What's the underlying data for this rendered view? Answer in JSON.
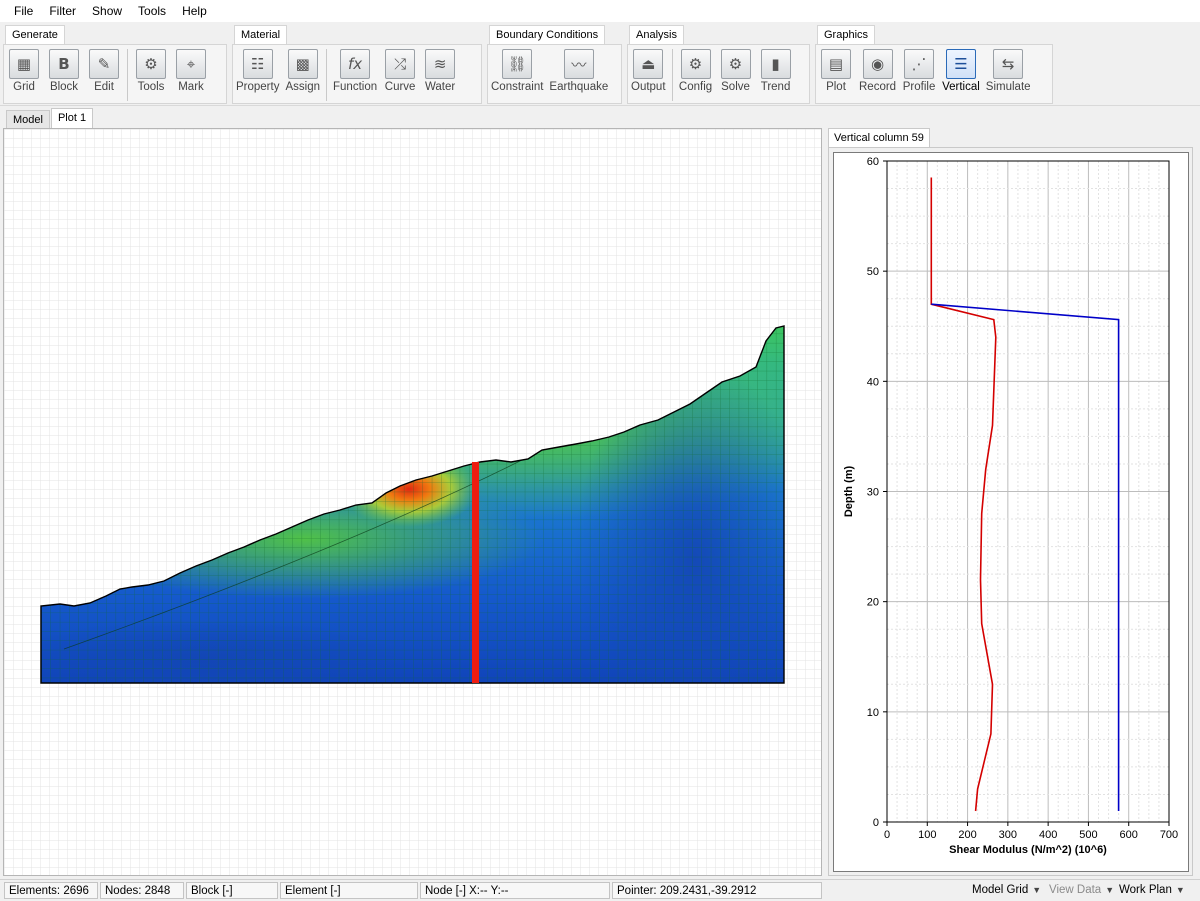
{
  "menu": [
    "File",
    "Filter",
    "Show",
    "Tools",
    "Help"
  ],
  "ribbon": {
    "groups": [
      {
        "label": "Generate",
        "buttons": [
          {
            "label": "Grid",
            "icon": "grid-icon"
          },
          {
            "label": "Block",
            "icon": "block-icon"
          },
          {
            "label": "Edit",
            "icon": "edit-icon"
          },
          {
            "label": "Tools",
            "icon": "gear-icon"
          },
          {
            "label": "Mark",
            "icon": "crosshair-icon"
          }
        ]
      },
      {
        "label": "Material",
        "buttons": [
          {
            "label": "Property",
            "icon": "property-icon"
          },
          {
            "label": "Assign",
            "icon": "assign-icon"
          },
          {
            "label": "Function",
            "icon": "function-icon"
          },
          {
            "label": "Curve",
            "icon": "curve-icon"
          },
          {
            "label": "Water",
            "icon": "water-icon"
          }
        ]
      },
      {
        "label": "Boundary Conditions",
        "buttons": [
          {
            "label": "Constraint",
            "icon": "constraint-icon"
          },
          {
            "label": "Earthquake",
            "icon": "earthquake-icon"
          }
        ]
      },
      {
        "label": "Analysis",
        "buttons": [
          {
            "label": "Output",
            "icon": "output-icon"
          },
          {
            "label": "Config",
            "icon": "config-icon"
          },
          {
            "label": "Solve",
            "icon": "solve-icon"
          },
          {
            "label": "Trend",
            "icon": "trend-icon"
          }
        ]
      },
      {
        "label": "Graphics",
        "buttons": [
          {
            "label": "Plot",
            "icon": "plot-icon"
          },
          {
            "label": "Record",
            "icon": "record-icon"
          },
          {
            "label": "Profile",
            "icon": "profile-icon"
          },
          {
            "label": "Vertical",
            "icon": "vertical-icon",
            "active": true
          },
          {
            "label": "Simulate",
            "icon": "simulate-icon"
          }
        ]
      }
    ]
  },
  "tabs": [
    "Model",
    "Plot 1"
  ],
  "active_tab": "Plot 1",
  "side_panel": {
    "tab_label": "Vertical column 59"
  },
  "chart_data": {
    "type": "line",
    "xlabel": "Shear Modulus (N/m^2) (10^6)",
    "ylabel": "Depth (m)",
    "xlim": [
      0,
      700
    ],
    "ylim": [
      0,
      60
    ],
    "xticks": [
      0,
      100,
      200,
      300,
      400,
      500,
      600,
      700
    ],
    "yticks": [
      0,
      10,
      20,
      30,
      40,
      50,
      60
    ],
    "grid": true,
    "series": [
      {
        "color": "#d40000",
        "points": [
          [
            110,
            58.5
          ],
          [
            110,
            47
          ],
          [
            265,
            45.6
          ],
          [
            270,
            44
          ],
          [
            262,
            36
          ],
          [
            245,
            32
          ],
          [
            235,
            28
          ],
          [
            232,
            22
          ],
          [
            235,
            18
          ],
          [
            262,
            12.5
          ],
          [
            258,
            8
          ],
          [
            225,
            3
          ],
          [
            220,
            1
          ]
        ]
      },
      {
        "color": "#0000c8",
        "points": [
          [
            110,
            47
          ],
          [
            575,
            45.6
          ],
          [
            575,
            1
          ]
        ]
      }
    ]
  },
  "status": {
    "elements": "Elements: 2696",
    "nodes": "Nodes: 2848",
    "block": "Block [-]",
    "element": "Element [-]",
    "node": "Node [-]  X:--  Y:--",
    "pointer": "Pointer: 209.2431,-39.2912",
    "model_grid": "Model Grid",
    "view_data": "View Data",
    "work_plan": "Work Plan"
  }
}
